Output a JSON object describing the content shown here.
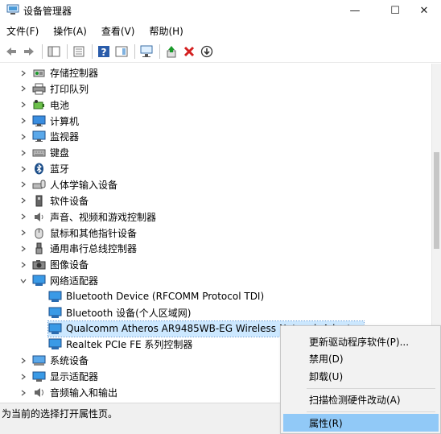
{
  "window": {
    "title": "设备管理器",
    "minimize_glyph": "—",
    "maximize_glyph": "☐",
    "close_glyph": "✕"
  },
  "menu": [
    "文件(F)",
    "操作(A)",
    "查看(V)",
    "帮助(H)"
  ],
  "tree": [
    {
      "label": "存储控制器",
      "icon": "storage-controller-icon",
      "expanded": false
    },
    {
      "label": "打印队列",
      "icon": "print-queue-icon",
      "expanded": false
    },
    {
      "label": "电池",
      "icon": "battery-icon",
      "expanded": false
    },
    {
      "label": "计算机",
      "icon": "computer-icon",
      "expanded": false
    },
    {
      "label": "监视器",
      "icon": "monitor-icon",
      "expanded": false
    },
    {
      "label": "键盘",
      "icon": "keyboard-icon",
      "expanded": false
    },
    {
      "label": "蓝牙",
      "icon": "bluetooth-icon",
      "expanded": false
    },
    {
      "label": "人体学输入设备",
      "icon": "hid-icon",
      "expanded": false
    },
    {
      "label": "软件设备",
      "icon": "software-device-icon",
      "expanded": false
    },
    {
      "label": "声音、视频和游戏控制器",
      "icon": "sound-icon",
      "expanded": false
    },
    {
      "label": "鼠标和其他指针设备",
      "icon": "mouse-icon",
      "expanded": false
    },
    {
      "label": "通用串行总线控制器",
      "icon": "usb-icon",
      "expanded": false
    },
    {
      "label": "图像设备",
      "icon": "camera-icon",
      "expanded": false
    },
    {
      "label": "网络适配器",
      "icon": "network-adapter-icon",
      "expanded": true
    },
    {
      "label": "Bluetooth Device (RFCOMM Protocol TDI)",
      "icon": "network-adapter-icon",
      "child": true
    },
    {
      "label": "Bluetooth 设备(个人区域网)",
      "icon": "network-adapter-icon",
      "child": true
    },
    {
      "label": "Qualcomm Atheros AR9485WB-EG Wireless Network Adapter",
      "icon": "network-adapter-icon",
      "child": true,
      "selected": true
    },
    {
      "label": "Realtek PCIe FE 系列控制器",
      "icon": "network-adapter-icon",
      "child": true
    },
    {
      "label": "系统设备",
      "icon": "system-device-icon",
      "expanded": false
    },
    {
      "label": "显示适配器",
      "icon": "display-adapter-icon",
      "expanded": false
    },
    {
      "label": "音频输入和输出",
      "icon": "audio-io-icon",
      "expanded": false
    }
  ],
  "status": "为当前的选择打开属性页。",
  "context_menu": [
    {
      "label": "更新驱动程序软件(P)..."
    },
    {
      "label": "禁用(D)"
    },
    {
      "label": "卸载(U)"
    },
    {
      "label": "扫描检测硬件改动(A)"
    },
    {
      "label": "属性(R)",
      "highlighted": true
    }
  ],
  "colors": {
    "selection": "#cce8ff",
    "menu_highlight": "#91c9f7",
    "accent": "#1e6fc8",
    "delete_red": "#d42020",
    "enable_green": "#1a9a2a"
  }
}
